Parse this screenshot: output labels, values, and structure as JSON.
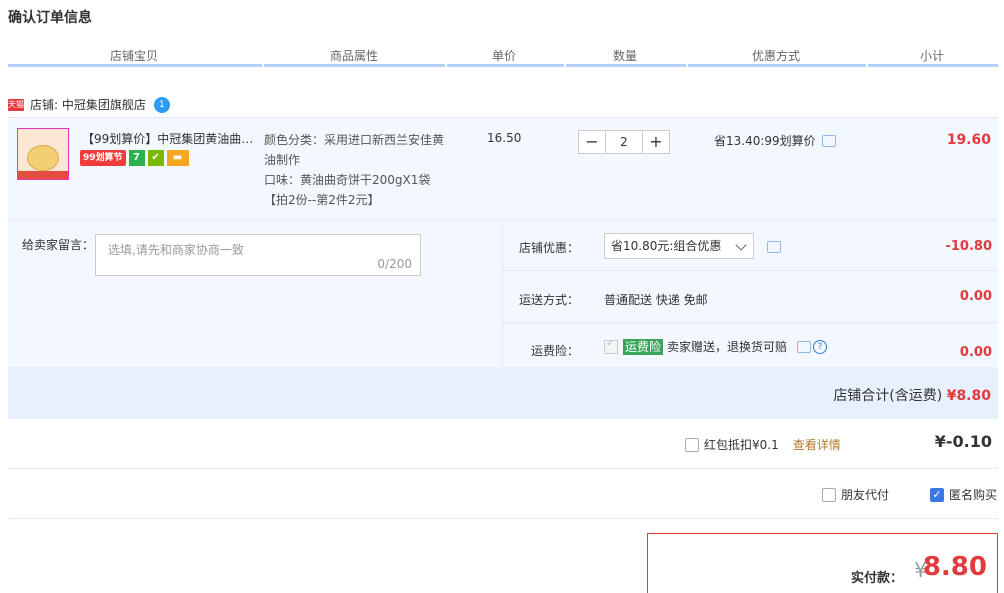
{
  "title": "确认订单信息",
  "columns": [
    "店铺宝贝",
    "商品属性",
    "单价",
    "数量",
    "优惠方式",
    "小计"
  ],
  "shop": {
    "tag": "天猫",
    "name": "店铺: 中冠集团旗舰店",
    "badge": "1"
  },
  "item": {
    "title": "【99划算价】中冠集团黄油曲…",
    "badge_99": "99划算节",
    "badge_7": "7",
    "attr_1": "颜色分类：采用进口新西兰安佳黄油制作",
    "attr_2": "口味：黄油曲奇饼干200gX1袋",
    "attr_3": "【拍2份--第2件2元】",
    "price": "16.50",
    "qty_minus": "−",
    "qty": "2",
    "qty_plus": "+",
    "promo": "省13.40:99划算价",
    "subtotal": "19.60"
  },
  "message": {
    "label": "给卖家留言：",
    "placeholder": "选填,请先和商家协商一致",
    "count": "0/200"
  },
  "options": {
    "shop_discount_label": "店铺优惠：",
    "shop_discount_select": "省10.80元:组合优惠",
    "shop_discount_amount": "-10.80",
    "shipping_label": "运送方式：",
    "shipping_value": "普通配送 快递 免邮",
    "shipping_amount": "0.00",
    "insurance_label": "运费险：",
    "insurance_tag": "运费险",
    "insurance_text": "卖家赠送，退换货可赔",
    "insurance_amount": "0.00"
  },
  "shop_total": {
    "label": "店铺合计(含运费)",
    "amount": "¥8.80"
  },
  "red_packet": {
    "label": "红包抵扣¥0.1",
    "link": "查看详情",
    "amount": "¥-0.10"
  },
  "friend_pay": "朋友代付",
  "anonymous": {
    "label": "匿名购买",
    "checked": "✓"
  },
  "payment": {
    "label": "实付款：",
    "currency": "¥",
    "amount": "8.80"
  },
  "colors": {
    "accent_red": "#e4393c",
    "table_border": "#b2d1ff",
    "row_bg": "#f3f8fe"
  }
}
